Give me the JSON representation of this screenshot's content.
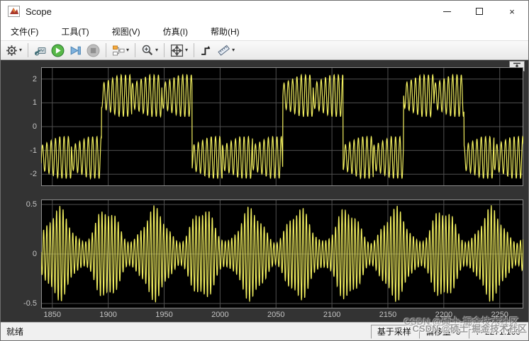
{
  "window": {
    "title": "Scope"
  },
  "icons": {
    "caret": "▾",
    "close": "×",
    "minimize-icon": "minimize (thin bar)",
    "maximize-icon": "maximize (square outline)",
    "app-icon": "simulink-scope-logo"
  },
  "menu": {
    "items": [
      {
        "label": "文件(F)"
      },
      {
        "label": "工具(T)"
      },
      {
        "label": "视图(V)"
      },
      {
        "label": "仿真(I)"
      },
      {
        "label": "帮助(H)"
      }
    ]
  },
  "toolbar": {
    "buttons": [
      {
        "name": "parameters",
        "icon": "gear-icon",
        "has_dropdown": true
      },
      {
        "name": "highlight-simulink-block",
        "icon": "goto-block-icon",
        "has_dropdown": false
      },
      {
        "name": "run",
        "icon": "play-icon",
        "has_dropdown": false
      },
      {
        "name": "step-forward",
        "icon": "step-forward-icon",
        "has_dropdown": false
      },
      {
        "name": "stop",
        "icon": "stop-icon",
        "has_dropdown": false,
        "disabled": true
      },
      {
        "name": "signal-selector",
        "icon": "signal-selector-icon",
        "has_dropdown": true
      },
      {
        "name": "zoom",
        "icon": "zoom-icon",
        "has_dropdown": true
      },
      {
        "name": "scale-axes",
        "icon": "span-arrows-icon",
        "has_dropdown": true
      },
      {
        "name": "trigger",
        "icon": "trigger-icon",
        "has_dropdown": false
      },
      {
        "name": "measurements",
        "icon": "ruler-icon",
        "has_dropdown": true
      }
    ]
  },
  "scope": {
    "background": "#333333",
    "tick_label_color": "#c5c5c5",
    "trace_color": "#f1ee5f"
  },
  "chart_data": [
    {
      "type": "line",
      "panel": "top",
      "x_range": [
        1840,
        2271.1
      ],
      "y_range": [
        -2.5,
        2.5
      ],
      "x_ticks": [
        1850,
        1900,
        1950,
        2000,
        2050,
        2100,
        2150,
        2200,
        2250
      ],
      "y_ticks": [
        2,
        1,
        0,
        -1,
        -2
      ],
      "x_tick_labels_visible": false,
      "grid": true,
      "grid_color": "#505050",
      "border_color": "#8c8c8c",
      "background": "#000000",
      "line_color": "#f1ee5f",
      "signal": {
        "description": "Bipolar digital waveform (~±1.3 levels, random bits) with superimposed sinusoidal ripple; peaks ≈ ±2.2",
        "synthesis": {
          "kind": "bipolar-bits-with-ripple",
          "bit_period": 27,
          "bit_level": 1.3,
          "ripple_period": 3.85,
          "ripple_amp_base": 0.5,
          "ripple_amp_var": 0.38,
          "seed": 7,
          "points": 2200
        }
      }
    },
    {
      "type": "line",
      "panel": "bottom",
      "x_range": [
        1840,
        2271.1
      ],
      "y_range": [
        -0.55,
        0.55
      ],
      "x_ticks": [
        1850,
        1900,
        1950,
        2000,
        2050,
        2100,
        2150,
        2200,
        2250
      ],
      "y_ticks": [
        0.5,
        0,
        -0.5
      ],
      "x_tick_labels_visible": true,
      "grid": true,
      "grid_color": "#505050",
      "border_color": "#8c8c8c",
      "background": "#000000",
      "line_color": "#f1ee5f",
      "signal": {
        "description": "Dense amplitude-modulated carrier; envelope varies ≈0.10–0.49, zero-mean",
        "synthesis": {
          "kind": "am-carrier",
          "carrier_period": 2.9,
          "amp_base": 0.28,
          "amp_var": 0.16,
          "am_period": 43,
          "am_period2": 16.7,
          "phase": 0.6,
          "points": 2600
        }
      }
    }
  ],
  "statusbar": {
    "status": "就绪",
    "sample_mode": "基于采样",
    "offset": "偏移量=0",
    "time": "T=2271.100"
  },
  "watermark": {
    "text": "CSDN @硕士-掘金技术社区"
  }
}
